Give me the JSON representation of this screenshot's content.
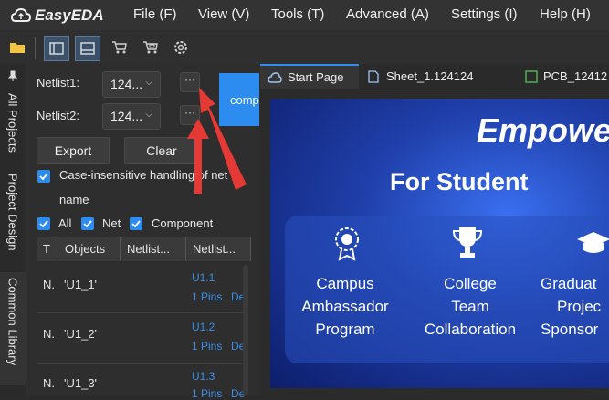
{
  "app": {
    "logo_text": "EasyEDA",
    "menu": [
      "File (F)",
      "View (V)",
      "Tools (T)",
      "Advanced (A)",
      "Settings (I)",
      "Help (H)"
    ]
  },
  "toolbar": {
    "icons": [
      "folder-icon",
      "left-panel-icon",
      "bottom-panel-icon",
      "cart-icon",
      "order-icon",
      "gear-icon"
    ]
  },
  "sidebar": {
    "tabs": [
      "All Projects",
      "Project Design",
      "Common Library"
    ]
  },
  "netlist_panel": {
    "netlist1_label": "Netlist1:",
    "netlist1_value": "124...",
    "netlist2_label": "Netlist2:",
    "netlist2_value": "124...",
    "browse_label": "···",
    "compare_label": "comp",
    "export_label": "Export",
    "clear_label": "Clear",
    "case_insensitive_label_line1": "Case-insensitive handling of net",
    "case_insensitive_label_line2": "name",
    "filter_all": "All",
    "filter_net": "Net",
    "filter_component": "Component",
    "table": {
      "headers": [
        "T",
        "Objects",
        "Netlist...",
        "Netlist..."
      ],
      "rows": [
        {
          "type": "N.",
          "object": "'U1_1'",
          "ref": "U1.1",
          "pins": "1 Pins",
          "extra": "De"
        },
        {
          "type": "N.",
          "object": "'U1_2'",
          "ref": "U1.2",
          "pins": "1 Pins",
          "extra": "De"
        },
        {
          "type": "N.",
          "object": "'U1_3'",
          "ref": "U1.3",
          "pins": "1 Pins",
          "extra": "De"
        }
      ]
    }
  },
  "tabs": {
    "start_page": "Start Page",
    "sheet": "Sheet_1.124124",
    "pcb": "PCB_12412"
  },
  "start_page": {
    "headline": "Empower",
    "subtitle": "For Student",
    "features": [
      {
        "icon": "ambassador-icon",
        "lines": [
          "Campus",
          "Ambassador",
          "Program"
        ]
      },
      {
        "icon": "trophy-icon",
        "lines": [
          "College",
          "Team",
          "Collaboration"
        ]
      },
      {
        "icon": "graduation-cap-icon",
        "lines": [
          "Graduat",
          "Projec",
          "Sponsor"
        ]
      }
    ]
  },
  "colors": {
    "accent": "#2d8cf0",
    "annotation_arrow": "#e53935",
    "link": "#3b8ee6"
  }
}
